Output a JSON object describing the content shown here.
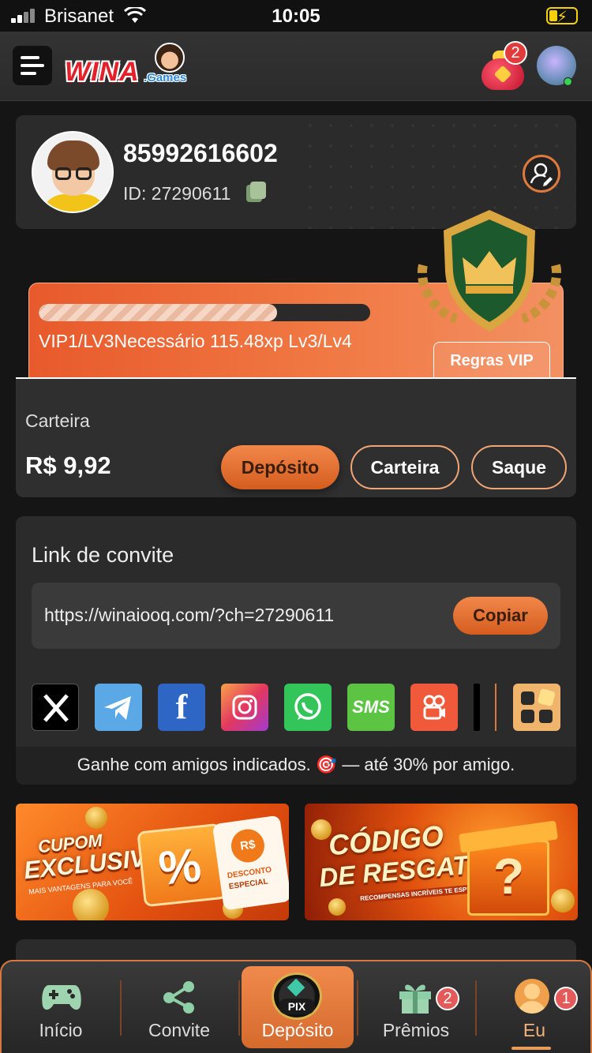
{
  "status": {
    "carrier": "Brisanet",
    "time": "10:05"
  },
  "header": {
    "logo_text": "WINA",
    "logo_sub": ".Games",
    "bag_badge": "2"
  },
  "profile": {
    "phone": "85992616602",
    "id_label": "ID: 27290611"
  },
  "vip": {
    "progress": 0.72,
    "text": "VIP1/LV3Necessário 115.48xp Lv3/Lv4",
    "rules_label": "Regras VIP"
  },
  "wallet": {
    "label": "Carteira",
    "amount": "R$ 9,92",
    "deposit_label": "Depósito",
    "wallet_label": "Carteira",
    "withdraw_label": "Saque"
  },
  "invite": {
    "title": "Link de convite",
    "url": "https://winaiooq.com/?ch=27290611",
    "copy_label": "Copiar",
    "share_sms": "SMS",
    "tip": "Ganhe com amigos indicados. 🎯 — até 30% por amigo."
  },
  "banners": {
    "coupon_line1": "CUPOM",
    "coupon_line2": "EXCLUSIVO",
    "coupon_sub": "MAIS VANTAGENS PARA VOCÊ",
    "coupon_ticket_currency": "R$",
    "coupon_ticket_line1": "DESCONTO",
    "coupon_ticket_line2": "ESPECIAL",
    "code_line1": "CÓDIGO",
    "code_line2": "DE RESGATE",
    "code_sub": "RECOMPENSAS INCRÍVEIS TE ESPERAM!"
  },
  "nav": {
    "home": "Início",
    "invite": "Convite",
    "deposit": "Depósito",
    "deposit_icon_text": "PIX",
    "prizes": "Prêmios",
    "prizes_badge": "2",
    "me": "Eu",
    "me_badge": "1"
  },
  "colors": {
    "accent": "#e07a3c",
    "card": "#2b2b2b",
    "background": "#151515"
  }
}
